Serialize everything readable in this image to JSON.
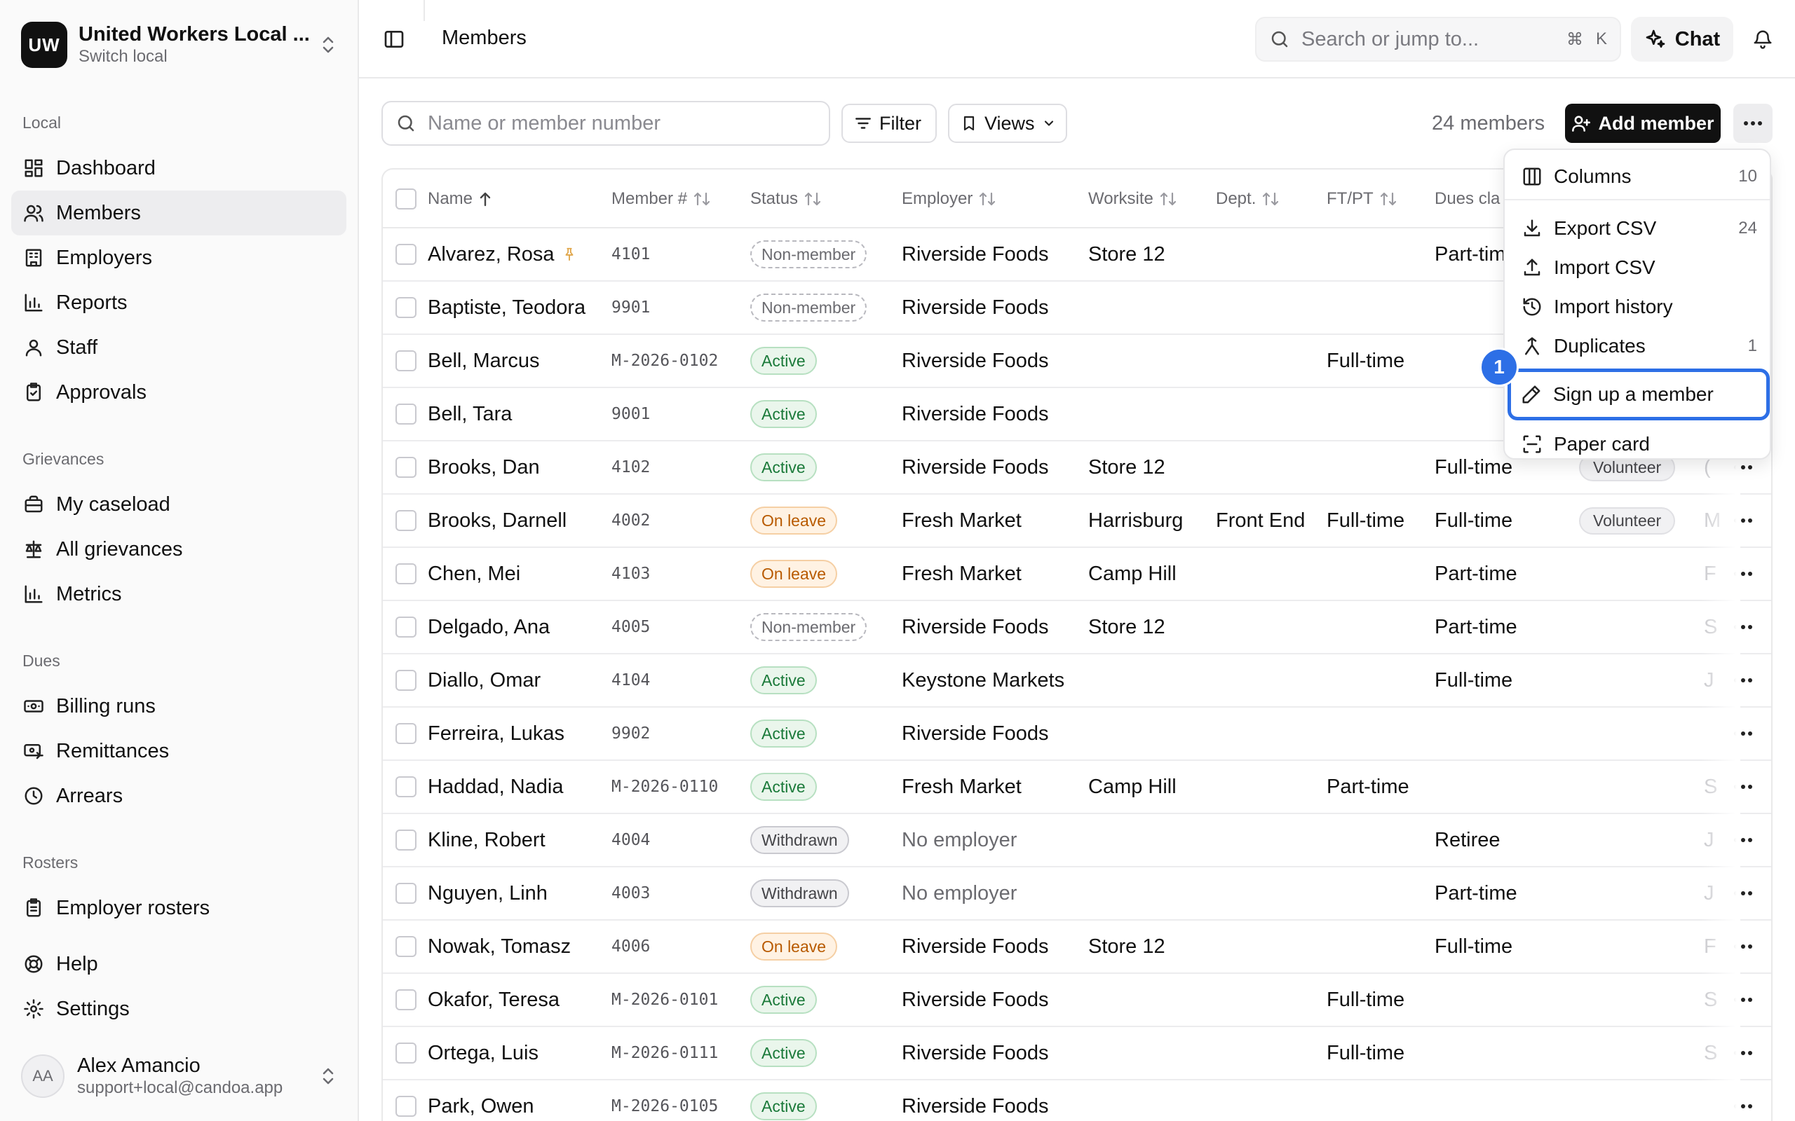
{
  "org": {
    "badge": "UW",
    "name": "United Workers Local ...",
    "subtitle": "Switch local"
  },
  "nav": {
    "local_label": "Local",
    "local": [
      {
        "label": "Dashboard",
        "icon": "dashboard-icon"
      },
      {
        "label": "Members",
        "icon": "members-icon",
        "active": true
      },
      {
        "label": "Employers",
        "icon": "building-icon"
      },
      {
        "label": "Reports",
        "icon": "bar-chart-icon"
      },
      {
        "label": "Staff",
        "icon": "user-icon"
      },
      {
        "label": "Approvals",
        "icon": "clipboard-check-icon"
      }
    ],
    "grievances_label": "Grievances",
    "grievances": [
      {
        "label": "My caseload",
        "icon": "briefcase-icon"
      },
      {
        "label": "All grievances",
        "icon": "scale-icon"
      },
      {
        "label": "Metrics",
        "icon": "bar-chart-icon"
      }
    ],
    "dues_label": "Dues",
    "dues": [
      {
        "label": "Billing runs",
        "icon": "banknote-icon"
      },
      {
        "label": "Remittances",
        "icon": "remittance-icon"
      },
      {
        "label": "Arrears",
        "icon": "clock-icon"
      }
    ],
    "rosters_label": "Rosters",
    "rosters": [
      {
        "label": "Employer rosters",
        "icon": "clipboard-list-icon"
      }
    ],
    "footer": [
      {
        "label": "Help",
        "icon": "life-buoy-icon"
      },
      {
        "label": "Settings",
        "icon": "gear-icon"
      }
    ]
  },
  "user": {
    "initials": "AA",
    "name": "Alex Amancio",
    "email": "support+local@candoa.app"
  },
  "topbar": {
    "title": "Members",
    "search_placeholder": "Search or jump to...",
    "kbd_cmd": "⌘",
    "kbd_key": "K",
    "chat_label": "Chat"
  },
  "toolbar": {
    "filter_placeholder": "Name or member number",
    "filter_label": "Filter",
    "views_label": "Views",
    "count_label": "24 members",
    "add_label": "Add member"
  },
  "table": {
    "headers": {
      "name": "Name",
      "member": "Member #",
      "status": "Status",
      "employer": "Employer",
      "worksite": "Worksite",
      "dept": "Dept.",
      "ftpt": "FT/PT",
      "dues": "Dues cla"
    },
    "rows": [
      {
        "name": "Alvarez, Rosa",
        "pinned": true,
        "num": "4101",
        "status": "Non-member",
        "employer": "Riverside Foods",
        "worksite": "Store 12",
        "dept": "",
        "ftpt": "",
        "dues": "Part-tim",
        "tag": "",
        "extra": ""
      },
      {
        "name": "Baptiste, Teodora",
        "num": "9901",
        "status": "Non-member",
        "employer": "Riverside Foods",
        "worksite": "",
        "dept": "",
        "ftpt": "",
        "dues": "",
        "tag": "",
        "extra": ""
      },
      {
        "name": "Bell, Marcus",
        "num": "M-2026-0102",
        "status": "Active",
        "employer": "Riverside Foods",
        "worksite": "",
        "dept": "",
        "ftpt": "Full-time",
        "dues": "",
        "tag": "",
        "extra": ""
      },
      {
        "name": "Bell, Tara",
        "num": "9001",
        "status": "Active",
        "employer": "Riverside Foods",
        "worksite": "",
        "dept": "",
        "ftpt": "",
        "dues": "",
        "tag": "",
        "extra": ""
      },
      {
        "name": "Brooks, Dan",
        "num": "4102",
        "status": "Active",
        "employer": "Riverside Foods",
        "worksite": "Store 12",
        "dept": "",
        "ftpt": "",
        "dues": "Full-time",
        "tag": "Volunteer",
        "extra": "("
      },
      {
        "name": "Brooks, Darnell",
        "num": "4002",
        "status": "On leave",
        "employer": "Fresh Market",
        "worksite": "Harrisburg",
        "dept": "Front End",
        "ftpt": "Full-time",
        "dues": "Full-time",
        "tag": "Volunteer",
        "extra": "M"
      },
      {
        "name": "Chen, Mei",
        "num": "4103",
        "status": "On leave",
        "employer": "Fresh Market",
        "worksite": "Camp Hill",
        "dept": "",
        "ftpt": "",
        "dues": "Part-time",
        "tag": "",
        "extra": "F"
      },
      {
        "name": "Delgado, Ana",
        "num": "4005",
        "status": "Non-member",
        "employer": "Riverside Foods",
        "worksite": "Store 12",
        "dept": "",
        "ftpt": "",
        "dues": "Part-time",
        "tag": "",
        "extra": "S"
      },
      {
        "name": "Diallo, Omar",
        "num": "4104",
        "status": "Active",
        "employer": "Keystone Markets",
        "worksite": "",
        "dept": "",
        "ftpt": "",
        "dues": "Full-time",
        "tag": "",
        "extra": "J"
      },
      {
        "name": "Ferreira, Lukas",
        "num": "9902",
        "status": "Active",
        "employer": "Riverside Foods",
        "worksite": "",
        "dept": "",
        "ftpt": "",
        "dues": "",
        "tag": "",
        "extra": ""
      },
      {
        "name": "Haddad, Nadia",
        "num": "M-2026-0110",
        "status": "Active",
        "employer": "Fresh Market",
        "worksite": "Camp Hill",
        "dept": "",
        "ftpt": "Part-time",
        "dues": "",
        "tag": "",
        "extra": "S"
      },
      {
        "name": "Kline, Robert",
        "num": "4004",
        "status": "Withdrawn",
        "employer": "No employer",
        "employer_muted": true,
        "worksite": "",
        "dept": "",
        "ftpt": "",
        "dues": "Retiree",
        "tag": "",
        "extra": "J"
      },
      {
        "name": "Nguyen, Linh",
        "num": "4003",
        "status": "Withdrawn",
        "employer": "No employer",
        "employer_muted": true,
        "worksite": "",
        "dept": "",
        "ftpt": "",
        "dues": "Part-time",
        "tag": "",
        "extra": "J"
      },
      {
        "name": "Nowak, Tomasz",
        "num": "4006",
        "status": "On leave",
        "employer": "Riverside Foods",
        "worksite": "Store 12",
        "dept": "",
        "ftpt": "",
        "dues": "Full-time",
        "tag": "",
        "extra": "F"
      },
      {
        "name": "Okafor, Teresa",
        "num": "M-2026-0101",
        "status": "Active",
        "employer": "Riverside Foods",
        "worksite": "",
        "dept": "",
        "ftpt": "Full-time",
        "dues": "",
        "tag": "",
        "extra": "S"
      },
      {
        "name": "Ortega, Luis",
        "num": "M-2026-0111",
        "status": "Active",
        "employer": "Riverside Foods",
        "worksite": "",
        "dept": "",
        "ftpt": "Full-time",
        "dues": "",
        "tag": "",
        "extra": "S"
      },
      {
        "name": "Park, Owen",
        "num": "M-2026-0105",
        "status": "Active",
        "employer": "Riverside Foods",
        "worksite": "",
        "dept": "",
        "ftpt": "",
        "dues": "",
        "tag": "",
        "extra": ""
      }
    ]
  },
  "menu": {
    "items": [
      {
        "label": "Columns",
        "count": "10",
        "icon": "columns-icon"
      },
      {
        "label": "Export CSV",
        "count": "24",
        "icon": "download-icon"
      },
      {
        "label": "Import CSV",
        "count": "",
        "icon": "upload-icon"
      },
      {
        "label": "Import history",
        "count": "",
        "icon": "history-icon"
      },
      {
        "label": "Duplicates",
        "count": "1",
        "icon": "merge-icon"
      },
      {
        "label": "Sign up a member",
        "count": "",
        "icon": "pen-icon",
        "highlighted": true
      },
      {
        "label": "Paper card",
        "count": "",
        "icon": "scan-icon"
      }
    ],
    "step_marker": "1"
  },
  "colors": {
    "accent": "#2d6fe6",
    "primary_button": "#111111",
    "active_green": "#1b7a3a",
    "leave_orange": "#b85a00"
  }
}
